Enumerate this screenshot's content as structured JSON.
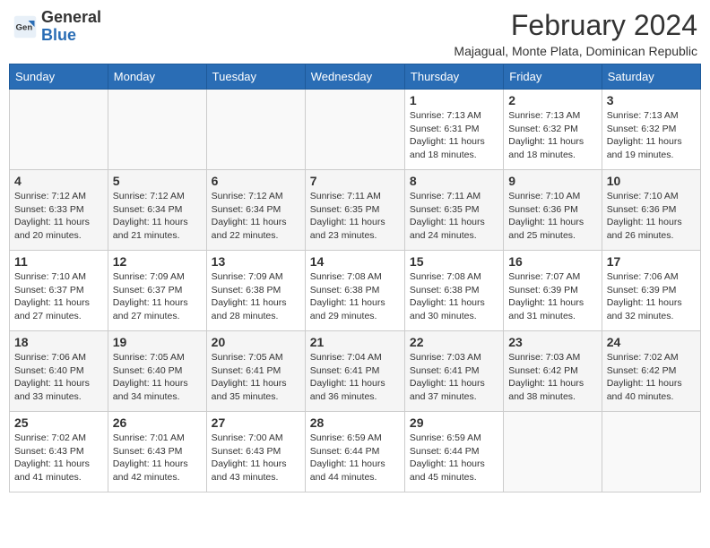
{
  "header": {
    "logo_general": "General",
    "logo_blue": "Blue",
    "month_year": "February 2024",
    "location": "Majagual, Monte Plata, Dominican Republic"
  },
  "weekdays": [
    "Sunday",
    "Monday",
    "Tuesday",
    "Wednesday",
    "Thursday",
    "Friday",
    "Saturday"
  ],
  "weeks": [
    [
      {
        "day": "",
        "info": ""
      },
      {
        "day": "",
        "info": ""
      },
      {
        "day": "",
        "info": ""
      },
      {
        "day": "",
        "info": ""
      },
      {
        "day": "1",
        "info": "Sunrise: 7:13 AM\nSunset: 6:31 PM\nDaylight: 11 hours\nand 18 minutes."
      },
      {
        "day": "2",
        "info": "Sunrise: 7:13 AM\nSunset: 6:32 PM\nDaylight: 11 hours\nand 18 minutes."
      },
      {
        "day": "3",
        "info": "Sunrise: 7:13 AM\nSunset: 6:32 PM\nDaylight: 11 hours\nand 19 minutes."
      }
    ],
    [
      {
        "day": "4",
        "info": "Sunrise: 7:12 AM\nSunset: 6:33 PM\nDaylight: 11 hours\nand 20 minutes."
      },
      {
        "day": "5",
        "info": "Sunrise: 7:12 AM\nSunset: 6:34 PM\nDaylight: 11 hours\nand 21 minutes."
      },
      {
        "day": "6",
        "info": "Sunrise: 7:12 AM\nSunset: 6:34 PM\nDaylight: 11 hours\nand 22 minutes."
      },
      {
        "day": "7",
        "info": "Sunrise: 7:11 AM\nSunset: 6:35 PM\nDaylight: 11 hours\nand 23 minutes."
      },
      {
        "day": "8",
        "info": "Sunrise: 7:11 AM\nSunset: 6:35 PM\nDaylight: 11 hours\nand 24 minutes."
      },
      {
        "day": "9",
        "info": "Sunrise: 7:10 AM\nSunset: 6:36 PM\nDaylight: 11 hours\nand 25 minutes."
      },
      {
        "day": "10",
        "info": "Sunrise: 7:10 AM\nSunset: 6:36 PM\nDaylight: 11 hours\nand 26 minutes."
      }
    ],
    [
      {
        "day": "11",
        "info": "Sunrise: 7:10 AM\nSunset: 6:37 PM\nDaylight: 11 hours\nand 27 minutes."
      },
      {
        "day": "12",
        "info": "Sunrise: 7:09 AM\nSunset: 6:37 PM\nDaylight: 11 hours\nand 27 minutes."
      },
      {
        "day": "13",
        "info": "Sunrise: 7:09 AM\nSunset: 6:38 PM\nDaylight: 11 hours\nand 28 minutes."
      },
      {
        "day": "14",
        "info": "Sunrise: 7:08 AM\nSunset: 6:38 PM\nDaylight: 11 hours\nand 29 minutes."
      },
      {
        "day": "15",
        "info": "Sunrise: 7:08 AM\nSunset: 6:38 PM\nDaylight: 11 hours\nand 30 minutes."
      },
      {
        "day": "16",
        "info": "Sunrise: 7:07 AM\nSunset: 6:39 PM\nDaylight: 11 hours\nand 31 minutes."
      },
      {
        "day": "17",
        "info": "Sunrise: 7:06 AM\nSunset: 6:39 PM\nDaylight: 11 hours\nand 32 minutes."
      }
    ],
    [
      {
        "day": "18",
        "info": "Sunrise: 7:06 AM\nSunset: 6:40 PM\nDaylight: 11 hours\nand 33 minutes."
      },
      {
        "day": "19",
        "info": "Sunrise: 7:05 AM\nSunset: 6:40 PM\nDaylight: 11 hours\nand 34 minutes."
      },
      {
        "day": "20",
        "info": "Sunrise: 7:05 AM\nSunset: 6:41 PM\nDaylight: 11 hours\nand 35 minutes."
      },
      {
        "day": "21",
        "info": "Sunrise: 7:04 AM\nSunset: 6:41 PM\nDaylight: 11 hours\nand 36 minutes."
      },
      {
        "day": "22",
        "info": "Sunrise: 7:03 AM\nSunset: 6:41 PM\nDaylight: 11 hours\nand 37 minutes."
      },
      {
        "day": "23",
        "info": "Sunrise: 7:03 AM\nSunset: 6:42 PM\nDaylight: 11 hours\nand 38 minutes."
      },
      {
        "day": "24",
        "info": "Sunrise: 7:02 AM\nSunset: 6:42 PM\nDaylight: 11 hours\nand 40 minutes."
      }
    ],
    [
      {
        "day": "25",
        "info": "Sunrise: 7:02 AM\nSunset: 6:43 PM\nDaylight: 11 hours\nand 41 minutes."
      },
      {
        "day": "26",
        "info": "Sunrise: 7:01 AM\nSunset: 6:43 PM\nDaylight: 11 hours\nand 42 minutes."
      },
      {
        "day": "27",
        "info": "Sunrise: 7:00 AM\nSunset: 6:43 PM\nDaylight: 11 hours\nand 43 minutes."
      },
      {
        "day": "28",
        "info": "Sunrise: 6:59 AM\nSunset: 6:44 PM\nDaylight: 11 hours\nand 44 minutes."
      },
      {
        "day": "29",
        "info": "Sunrise: 6:59 AM\nSunset: 6:44 PM\nDaylight: 11 hours\nand 45 minutes."
      },
      {
        "day": "",
        "info": ""
      },
      {
        "day": "",
        "info": ""
      }
    ]
  ]
}
